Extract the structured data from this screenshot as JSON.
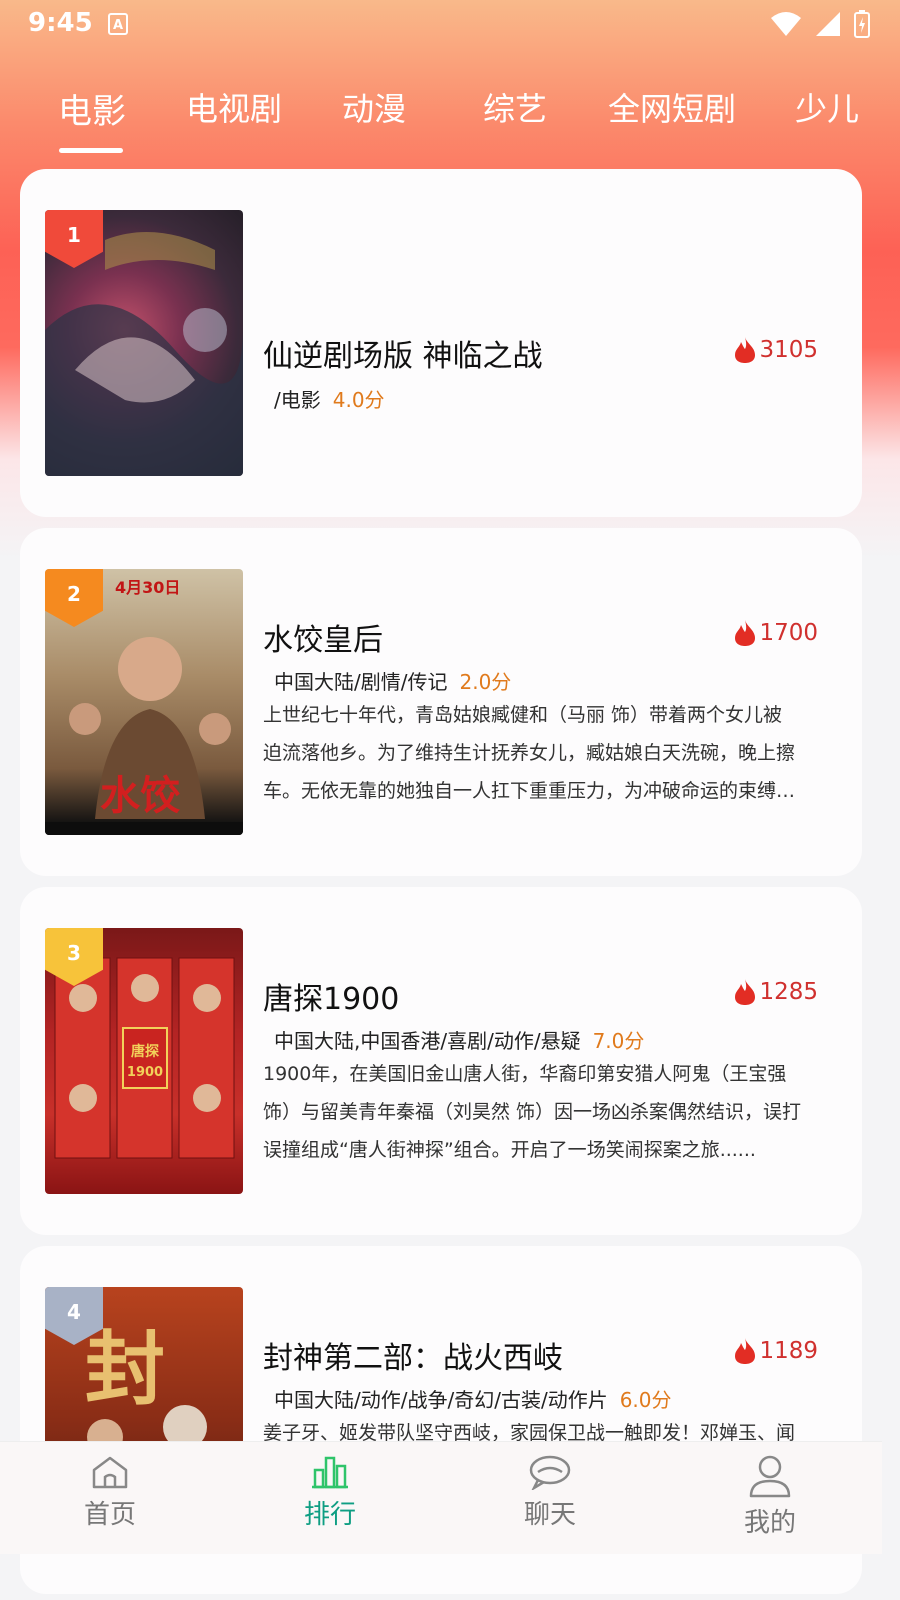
{
  "status": {
    "time": "9:45",
    "notif": "A"
  },
  "tabs": [
    "电影",
    "电视剧",
    "动漫",
    "综艺",
    "全网短剧",
    "少儿"
  ],
  "items": [
    {
      "rank": "1",
      "title": "仙逆剧场版 神临之战",
      "hot": "3105",
      "meta": "/电影",
      "score": "4.0分",
      "desc": []
    },
    {
      "rank": "2",
      "title": "水饺皇后",
      "hot": "1700",
      "meta": "中国大陆/剧情/传记",
      "score": "2.0分",
      "poster_text": "4月30日",
      "desc": [
        "上世纪七十年代，青岛姑娘臧健和（马丽 饰）带着两个女儿被",
        "迫流落他乡。为了维持生计抚养女儿，臧姑娘白天洗碗，晚上擦",
        "车。无依无靠的她独自一人扛下重重压力，为冲破命运的束缚…"
      ]
    },
    {
      "rank": "3",
      "title": "唐探1900",
      "hot": "1285",
      "meta": "中国大陆,中国香港/喜剧/动作/悬疑",
      "score": "7.0分",
      "poster_text": "唐探1900",
      "desc": [
        "1900年，在美国旧金山唐人街，华裔印第安猎人阿鬼（王宝强",
        "饰）与留美青年秦福（刘昊然 饰）因一场凶杀案偶然结识，误打",
        "误撞组成“唐人街神探”组合。开启了一场笑闹探案之旅......"
      ]
    },
    {
      "rank": "4",
      "title": "封神第二部：战火西岐",
      "hot": "1189",
      "meta": "中国大陆/动作/战争/奇幻/古装/动作片",
      "score": "6.0分",
      "poster_text": "封",
      "desc": [
        "姜子牙、姬发带队坚守西岐，家园保卫战一触即发！邓婵玉、闻"
      ]
    }
  ],
  "nav": [
    "首页",
    "排行",
    "聊天",
    "我的"
  ],
  "colors": {
    "badge1": "#f04a3a",
    "badge2": "#f58a1f",
    "badge3": "#f7c33a",
    "badge4": "#a8b2c6",
    "accent": "#0e9e83",
    "hot": "#d0302e",
    "score": "#e07a1c"
  }
}
